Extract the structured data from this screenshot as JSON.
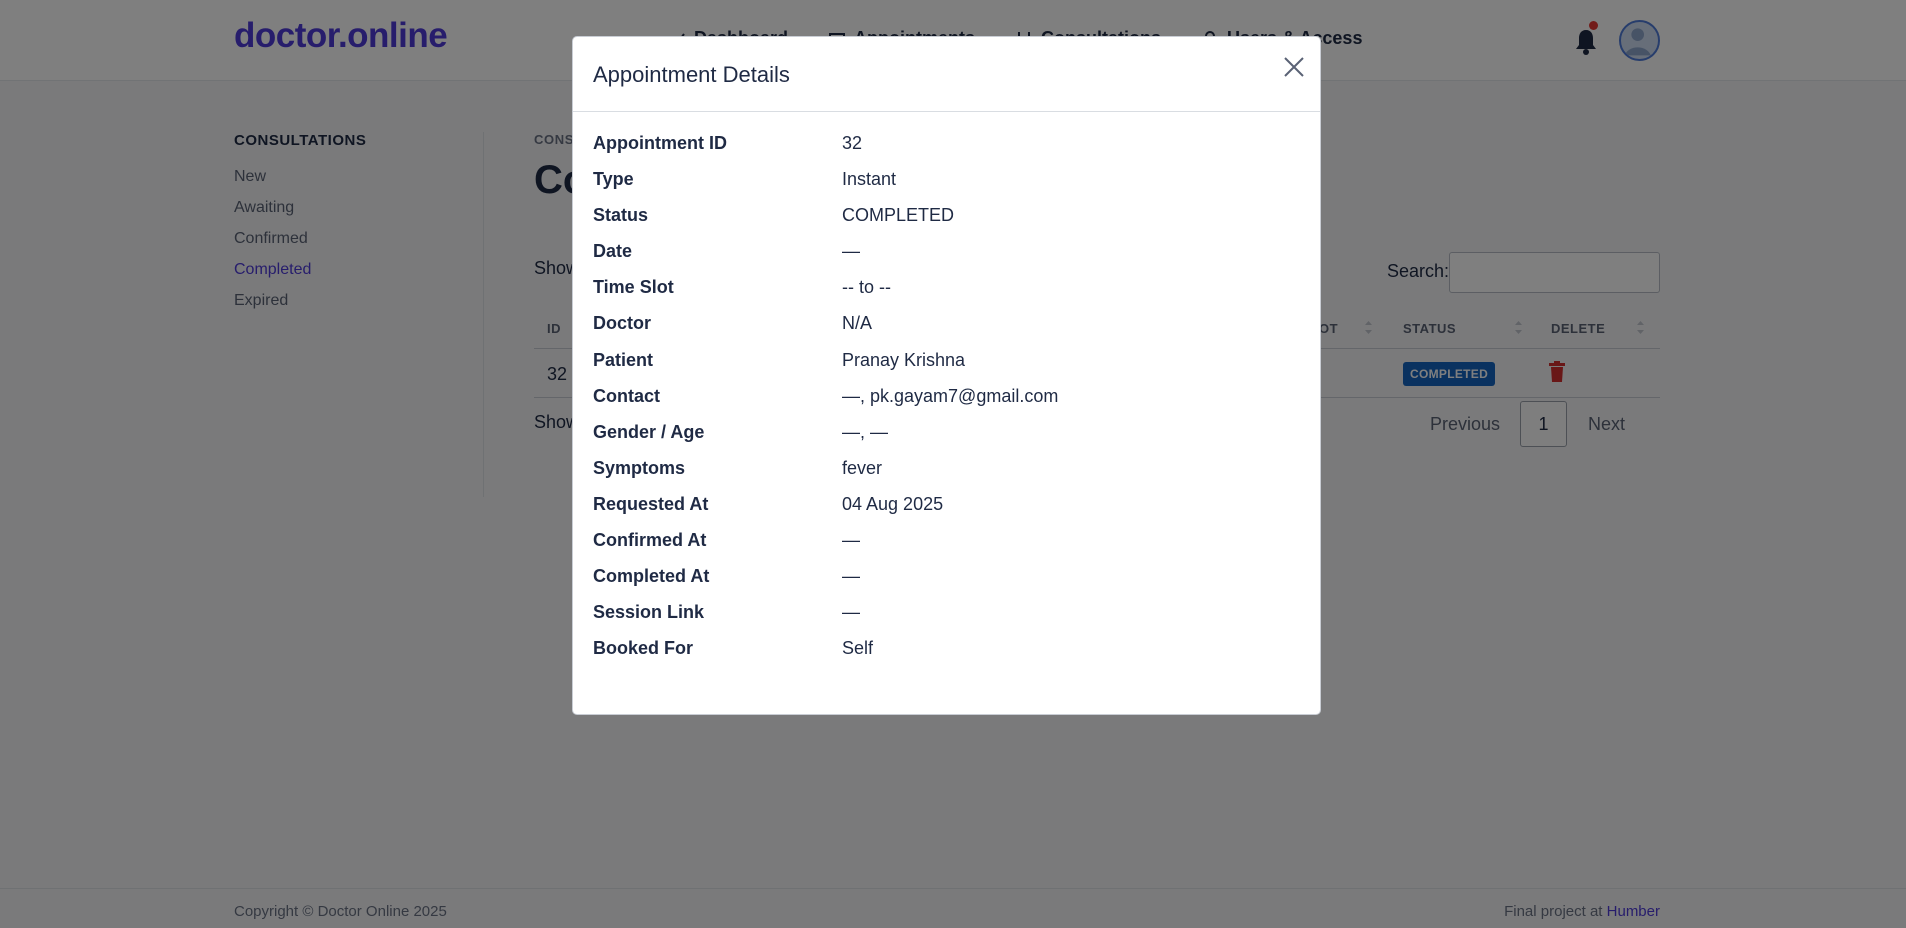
{
  "brand": "doctor.online",
  "nav": {
    "items": [
      {
        "label": "Dashboard"
      },
      {
        "label": "Appointments"
      },
      {
        "label": "Consultations"
      },
      {
        "label": "Users & Access"
      }
    ]
  },
  "sidebar": {
    "title": "CONSULTATIONS",
    "items": [
      {
        "label": "New"
      },
      {
        "label": "Awaiting"
      },
      {
        "label": "Confirmed"
      },
      {
        "label": "Completed"
      },
      {
        "label": "Expired"
      }
    ]
  },
  "main": {
    "breadcrumb": "CONS",
    "title": "Co",
    "show_entries": "Show",
    "search_label": "Search:",
    "table": {
      "headers": {
        "id": "ID",
        "slot": "OT",
        "status": "STATUS",
        "delete": "DELETE"
      },
      "rows": [
        {
          "id": "32",
          "status": "COMPLETED"
        }
      ]
    },
    "showing": "Show",
    "pagination": {
      "previous": "Previous",
      "page": "1",
      "next": "Next"
    }
  },
  "footer": {
    "copyright": "Copyright © Doctor Online 2025",
    "credit_prefix": "Final project at ",
    "credit_link": "Humber"
  },
  "modal": {
    "title": "Appointment Details",
    "fields": [
      {
        "label": "Appointment ID",
        "value": "32"
      },
      {
        "label": "Type",
        "value": "Instant"
      },
      {
        "label": "Status",
        "value": "COMPLETED"
      },
      {
        "label": "Date",
        "value": "—"
      },
      {
        "label": "Time Slot",
        "value": "-- to --"
      },
      {
        "label": "Doctor",
        "value": "N/A"
      },
      {
        "label": "Patient",
        "value": "Pranay Krishna"
      },
      {
        "label": "Contact",
        "value": "—, pk.gayam7@gmail.com"
      },
      {
        "label": "Gender / Age",
        "value": "—, —"
      },
      {
        "label": "Symptoms",
        "value": "fever"
      },
      {
        "label": "Requested At",
        "value": "04 Aug 2025"
      },
      {
        "label": "Confirmed At",
        "value": "—"
      },
      {
        "label": "Completed At",
        "value": "—"
      },
      {
        "label": "Session Link",
        "value": "—"
      },
      {
        "label": "Booked For",
        "value": "Self"
      }
    ]
  },
  "colors": {
    "brand": "#4f3bd8",
    "status_badge": "#1565c0",
    "delete": "#d32f2f",
    "notification_dot": "#e53935"
  }
}
